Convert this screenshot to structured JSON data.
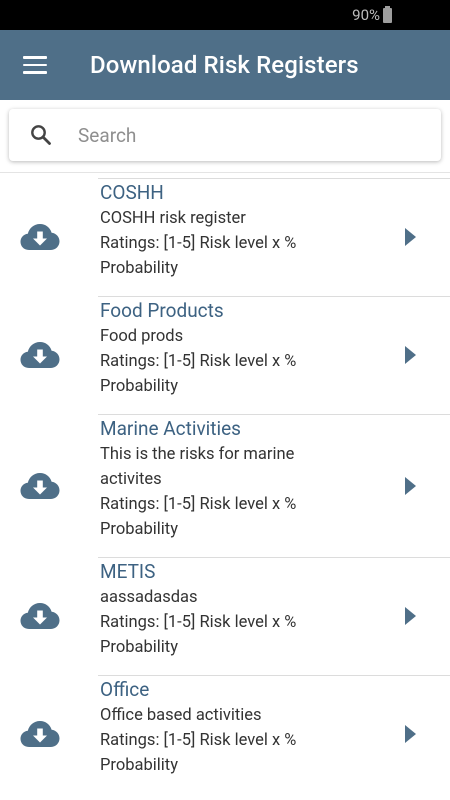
{
  "status": {
    "battery": "90%"
  },
  "header": {
    "title": "Download Risk Registers"
  },
  "search": {
    "placeholder": "Search"
  },
  "items": [
    {
      "name": "COSHH",
      "lines": [
        "COSHH risk register",
        "Ratings: [1-5] Risk level x %",
        "Probability"
      ]
    },
    {
      "name": "Food Products",
      "lines": [
        "Food prods",
        "Ratings: [1-5] Risk level x %",
        "Probability"
      ]
    },
    {
      "name": "Marine Activities",
      "lines": [
        "This is the risks for marine",
        "activites",
        "Ratings: [1-5] Risk level x %",
        "Probability"
      ]
    },
    {
      "name": "METIS",
      "lines": [
        "aassadasdas",
        "Ratings: [1-5] Risk level x %",
        "Probability"
      ]
    },
    {
      "name": "Office",
      "lines": [
        "Office based activities",
        "Ratings: [1-5] Risk level x %",
        "Probability"
      ]
    }
  ],
  "colors": {
    "appbar": "#4f6f88",
    "accent": "#3d6282"
  },
  "icons": {
    "download": "cloud-download-icon",
    "open": "chevron-right-icon",
    "menu": "menu-icon",
    "search": "search-icon"
  }
}
